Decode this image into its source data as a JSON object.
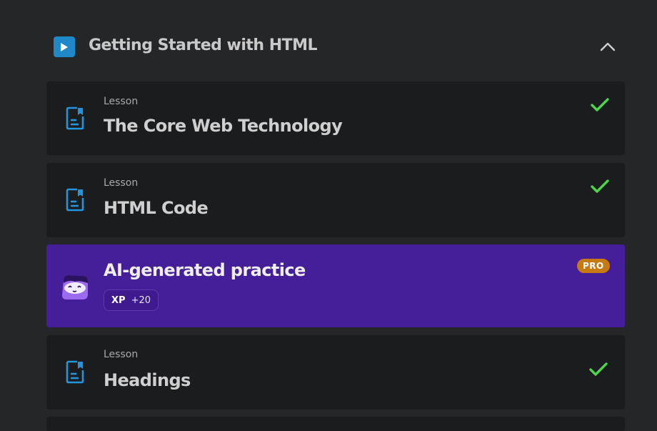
{
  "module": {
    "title": "Getting Started with HTML"
  },
  "lessons": [
    {
      "kind": "Lesson",
      "title": "The Core Web Technology",
      "completed": true
    },
    {
      "kind": "Lesson",
      "title": "HTML Code",
      "completed": true
    },
    {
      "kind": "Lesson",
      "title": "Headings",
      "completed": true
    }
  ],
  "ai_practice": {
    "title": "AI-generated practice",
    "badge": "PRO",
    "xp_label": "XP",
    "xp_value": "+20"
  },
  "colors": {
    "accent_blue": "#1e88c9",
    "check_green": "#4ed44e",
    "ai_purple": "#451e99",
    "pro_orange": "#c57a12"
  },
  "icons": {
    "module": "play-icon",
    "collapse": "chevron-up-icon",
    "lesson": "document-icon",
    "completed": "checkmark-icon",
    "ai": "mascot-icon"
  }
}
